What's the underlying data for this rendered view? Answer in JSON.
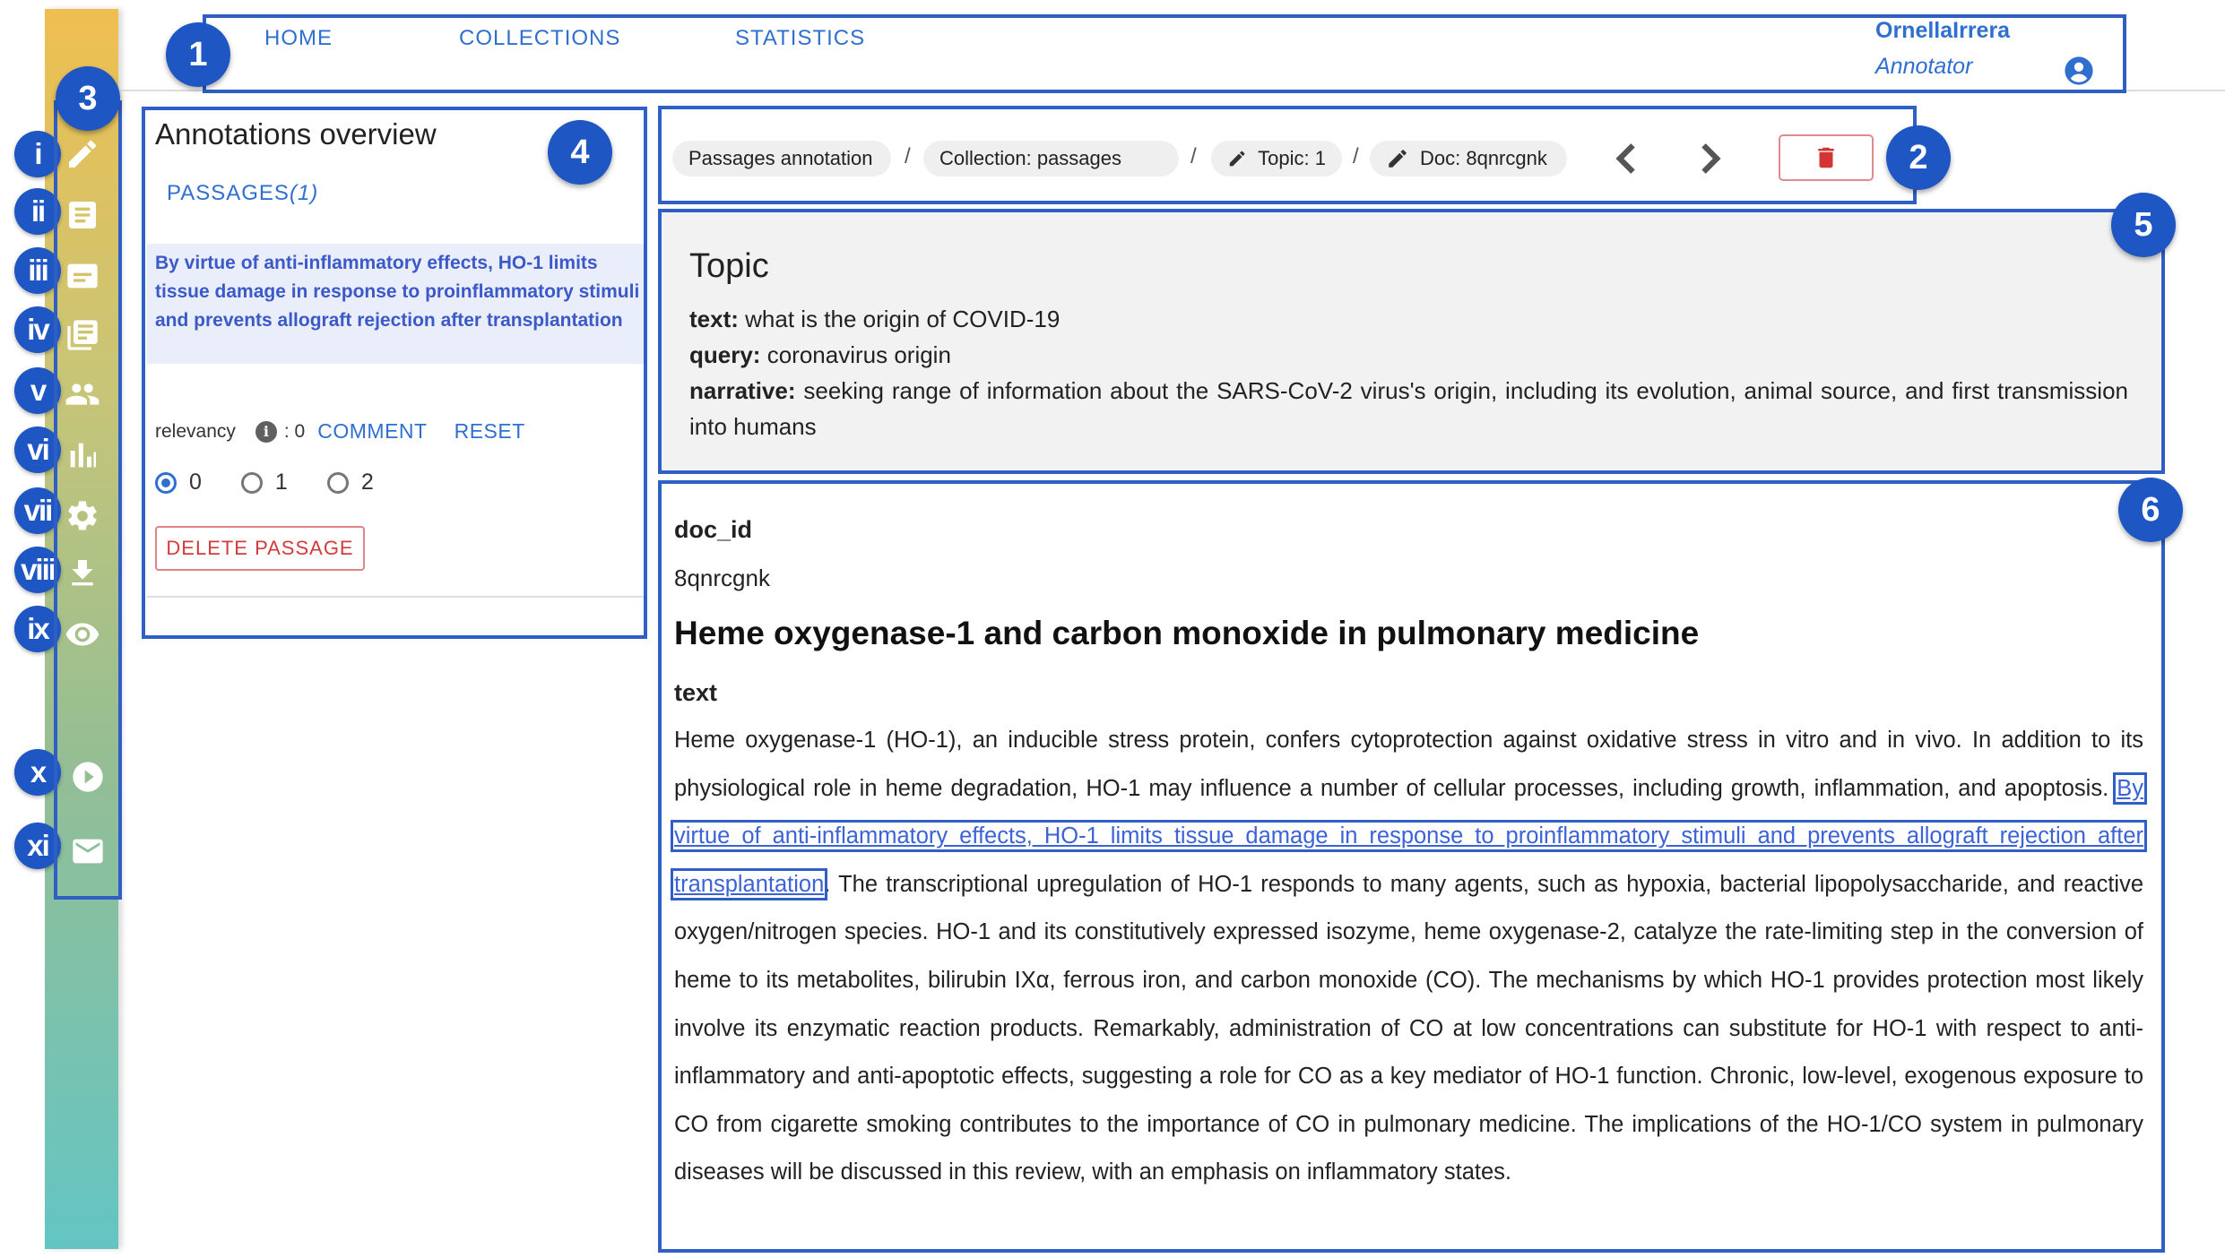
{
  "nav": {
    "home": "HOME",
    "collections": "COLLECTIONS",
    "statistics": "STATISTICS",
    "user_name": "OrnellaIrrera",
    "user_role": "Annotator"
  },
  "badges": [
    "1",
    "2",
    "3",
    "4",
    "5",
    "6"
  ],
  "sidebar": {
    "items": [
      {
        "label": "i",
        "icon": "pencil-icon"
      },
      {
        "label": "ii",
        "icon": "document-icon"
      },
      {
        "label": "iii",
        "icon": "passages-icon"
      },
      {
        "label": "iv",
        "icon": "collections-icon"
      },
      {
        "label": "v",
        "icon": "people-icon"
      },
      {
        "label": "vi",
        "icon": "statistics-icon"
      },
      {
        "label": "vii",
        "icon": "gear-icon"
      },
      {
        "label": "viii",
        "icon": "download-icon"
      },
      {
        "label": "ix",
        "icon": "eye-icon"
      },
      {
        "label": "x",
        "icon": "play-circle-icon"
      },
      {
        "label": "xi",
        "icon": "mail-icon"
      }
    ]
  },
  "overview": {
    "title": "Annotations overview",
    "passages_label": "PASSAGES",
    "passages_count": "(1)",
    "passage_text": "By virtue of anti-inflammatory effects, HO-1 limits tissue damage in response to proinflammatory stimuli and prevents allograft rejection after transplantation",
    "relevancy_label": "relevancy",
    "relevancy_value": ": 0",
    "comment": "COMMENT",
    "reset": "RESET",
    "options": [
      "0",
      "1",
      "2"
    ],
    "selected": "0",
    "delete_passage": "DELETE PASSAGE"
  },
  "breadcrumb": {
    "task": "Passages annotation",
    "collection": "Collection: passages",
    "topic": "Topic: 1",
    "doc": "Doc: 8qnrcgnk",
    "separator": "/"
  },
  "topic": {
    "heading": "Topic",
    "text_label": "text:",
    "text": "what is the origin of COVID-19",
    "query_label": "query:",
    "query": "coronavirus origin",
    "narrative_label": "narrative:",
    "narrative": "seeking range of information about the SARS-CoV-2 virus's origin, including its evolution, animal source, and first transmission into humans"
  },
  "document": {
    "id_label": "doc_id",
    "id": "8qnrcgnk",
    "title": "Heme oxygenase-1 and carbon monoxide in pulmonary medicine",
    "text_label": "text",
    "text_before": "Heme oxygenase-1 (HO-1), an inducible stress protein, confers cytoprotection against oxidative stress in vitro and in vivo. In addition to its physiological role in heme degradation, HO-1 may influence a number of cellular processes, including growth, inflammation, and apoptosis. ",
    "text_highlight": "By virtue of anti-inflammatory effects, HO-1 limits tissue damage in response to proinflammatory stimuli and prevents allograft rejection after transplantation",
    "text_after": ". The transcriptional upregulation of HO-1 responds to many agents, such as hypoxia, bacterial lipopolysaccharide, and reactive oxygen/nitrogen species. HO-1 and its constitutively expressed isozyme, heme oxygenase-2, catalyze the rate-limiting step in the conversion of heme to its metabolites, bilirubin IXα, ferrous iron, and carbon monoxide (CO). The mechanisms by which HO-1 provides protection most likely involve its enzymatic reaction products. Remarkably, administration of CO at low concentrations can substitute for HO-1 with respect to anti-inflammatory and anti-apoptotic effects, suggesting a role for CO as a key mediator of HO-1 function. Chronic, low-level, exogenous exposure to CO from cigarette smoking contributes to the importance of CO in pulmonary medicine. The implications of the HO-1/CO system in pulmonary diseases will be discussed in this review, with an emphasis on inflammatory states."
  },
  "colors": {
    "accent": "#2f6fd0",
    "annotation_frame": "#2f5fc4",
    "badge": "#1e56c4",
    "highlight_text": "#3b59c8",
    "danger": "#d33535"
  }
}
